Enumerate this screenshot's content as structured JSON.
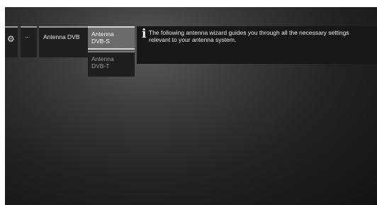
{
  "breadcrumbs": {
    "settings_icon": "gear-icon",
    "more_label": "...",
    "antenna_label": "Antenna DVB"
  },
  "dropdown": {
    "options": [
      {
        "line1": "Antenna",
        "line2": "DVB-S",
        "selected": true
      },
      {
        "line1": "Antenna",
        "line2": "DVB-T",
        "selected": false
      }
    ]
  },
  "info": {
    "icon": "info-icon",
    "text": "The following antenna wizard guides you through all the necessary settings relevant to your antenna system."
  },
  "colors": {
    "selected_bg": "#6b6b6b",
    "panel_bg": "#171717"
  }
}
